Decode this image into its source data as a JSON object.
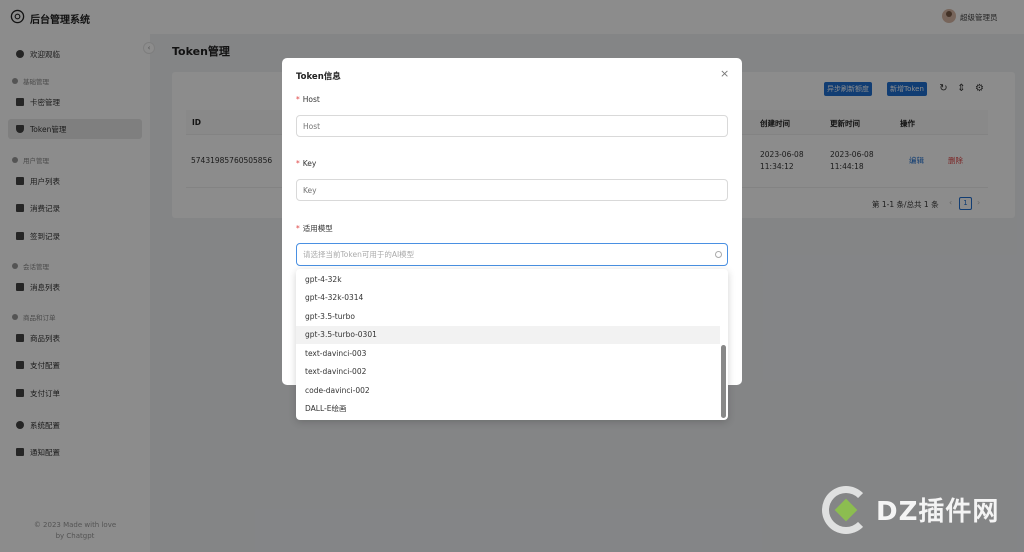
{
  "header": {
    "app_title": "后台管理系统",
    "username": "超级管理员"
  },
  "sidebar": {
    "collapse_icon": "‹",
    "items": [
      {
        "label": "欢迎观临",
        "icon": "home-icon"
      },
      {
        "group": "基础管理"
      },
      {
        "label": "卡密管理",
        "icon": "lock-icon"
      },
      {
        "label": "Token管理",
        "icon": "shield-icon",
        "active": true
      },
      {
        "group": "用户管理"
      },
      {
        "label": "用户列表",
        "icon": "user-list-icon"
      },
      {
        "label": "消费记录",
        "icon": "consume-icon"
      },
      {
        "label": "签到记录",
        "icon": "signin-icon"
      },
      {
        "group": "会话管理"
      },
      {
        "label": "消息列表",
        "icon": "message-icon"
      },
      {
        "group": "商品和订单"
      },
      {
        "label": "商品列表",
        "icon": "goods-icon"
      },
      {
        "label": "支付配置",
        "icon": "pay-config-icon"
      },
      {
        "label": "支付订单",
        "icon": "order-icon"
      },
      {
        "label": "系统配置",
        "icon": "settings-icon"
      },
      {
        "label": "通知配置",
        "icon": "notify-icon"
      }
    ],
    "footer_line1": "© 2023 Made with love",
    "footer_line2": "by Chatgpt"
  },
  "main": {
    "title": "Token管理",
    "toolbar": {
      "refresh_quota": "异步刷新额度",
      "add_token": "新增Token"
    },
    "table": {
      "headers": {
        "id": "ID",
        "created": "创建时间",
        "updated": "更新时间",
        "actions": "操作"
      },
      "rows": [
        {
          "id": "57431985760505856",
          "created_date": "2023-06-08",
          "created_time": "11:34:12",
          "updated_date": "2023-06-08",
          "updated_time": "11:44:18",
          "edit": "编辑",
          "delete": "删除"
        }
      ]
    },
    "pager": {
      "summary": "第 1-1 条/总共 1 条",
      "current": "1",
      "prev": "‹",
      "next": "›"
    }
  },
  "modal": {
    "title": "Token信息",
    "close": "×",
    "fields": {
      "host": {
        "label": "Host",
        "placeholder": "Host"
      },
      "key": {
        "label": "Key",
        "placeholder": "Key"
      },
      "model": {
        "label": "适用模型",
        "placeholder": "请选择当前Token可用于的AI模型"
      }
    },
    "required_mark": "*",
    "options": [
      "gpt-4-32k",
      "gpt-4-32k-0314",
      "gpt-3.5-turbo",
      "gpt-3.5-turbo-0301",
      "text-davinci-003",
      "text-davinci-002",
      "code-davinci-002",
      "DALL-E绘画"
    ],
    "hovered_option": "gpt-3.5-turbo-0301"
  },
  "watermark": {
    "text": "DZ插件网"
  }
}
